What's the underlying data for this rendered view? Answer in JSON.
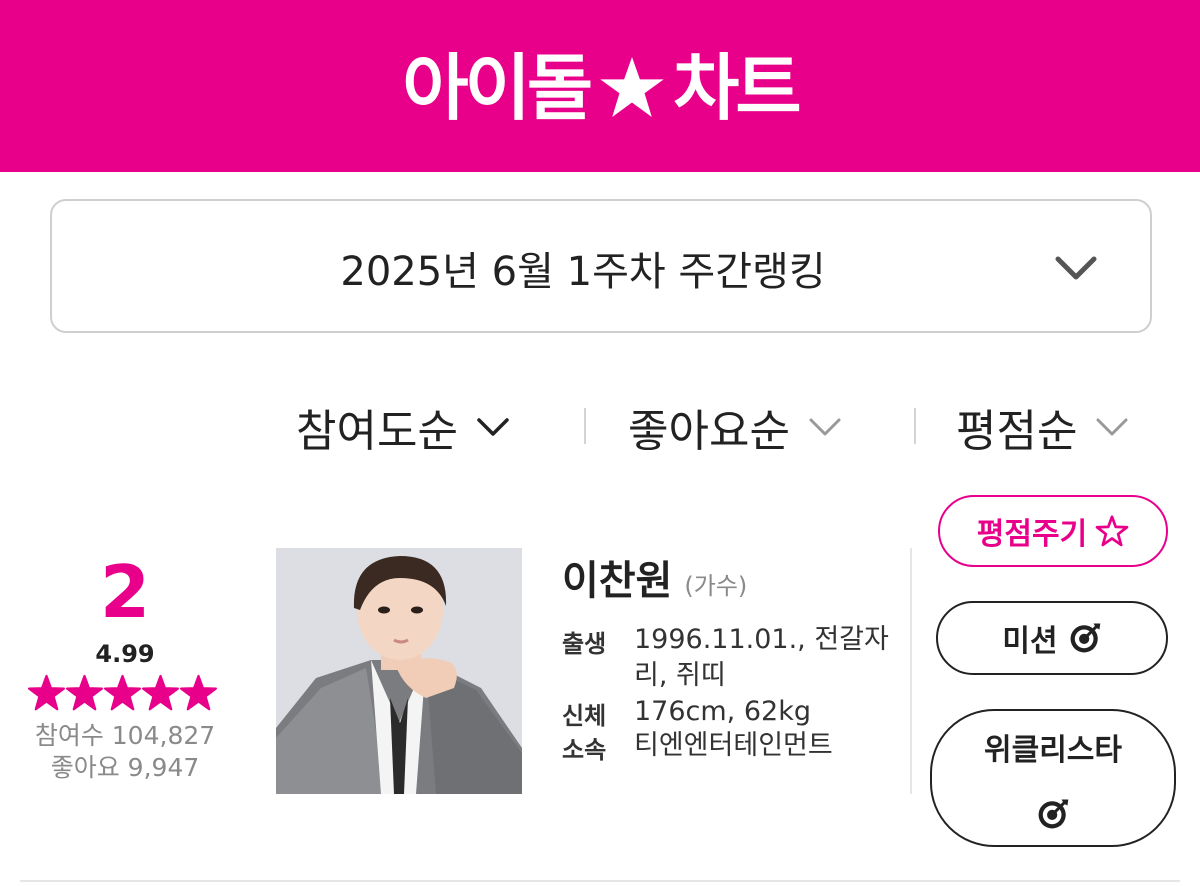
{
  "header": {
    "logo_left": "아이돌",
    "logo_right": "차트",
    "logo_star_icon": "star-icon",
    "brand_color": "#e8008b"
  },
  "week_select": {
    "label": "2025년 6월 1주차 주간랭킹",
    "icon": "chevron-down-icon"
  },
  "sort": {
    "items": [
      {
        "label": "참여도순",
        "active": true
      },
      {
        "label": "좋아요순",
        "active": false
      },
      {
        "label": "평점순",
        "active": false
      }
    ]
  },
  "entry": {
    "rank": "2",
    "rating": "4.99",
    "stars": 5,
    "participants": "참여수 104,827",
    "likes": "좋아요 9,947",
    "name": "이찬원",
    "role": "(가수)",
    "info": {
      "birth_label": "출생",
      "birth_value": "1996.11.01., 전갈자리, 쥐띠",
      "body_label": "신체",
      "body_value": "176cm, 62kg",
      "agency_label": "소속",
      "agency_value": "티엔엔터테인먼트"
    }
  },
  "actions": {
    "rate_label": "평점주기",
    "mission_label": "미션",
    "weekly_label": "위클리스타"
  }
}
